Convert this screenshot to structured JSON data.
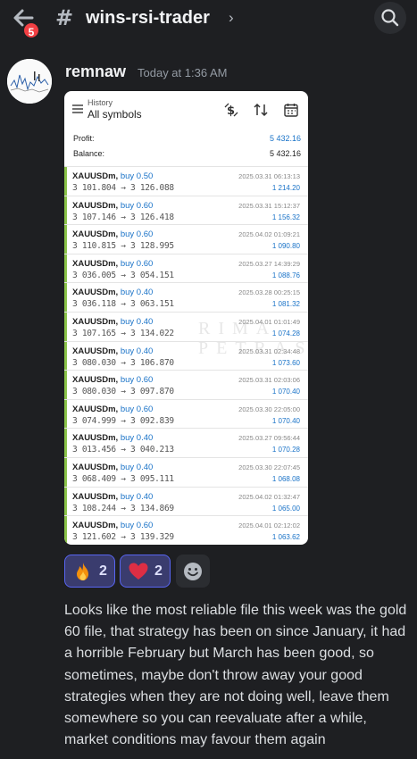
{
  "header": {
    "channel_name": "wins-rsi-trader",
    "unread_count": "5",
    "channel_prefix": "#",
    "chevron": "›"
  },
  "message": {
    "author": "remnaw",
    "timestamp": "Today at 1:36 AM",
    "text": "Looks like the most reliable file this week was the gold 60 file, that strategy has been on since January,  it had a horrible February but March has been good, so sometimes, maybe don't throw away your good strategies when they are not doing well, leave them somewhere so you can reevaluate after a while, market conditions may favour them again"
  },
  "attachment": {
    "history_label": "History",
    "filter_label": "All symbols",
    "profit_label": "Profit:",
    "profit_value": "5 432.16",
    "balance_label": "Balance:",
    "balance_value": "5 432.16",
    "watermark_line1": "RIMA",
    "watermark_line2": "PETRAS",
    "trades": [
      {
        "symbol": "XAUUSDm,",
        "side": "buy 0.50",
        "prices": "3 101.804 → 3 126.088",
        "datetime": "2025.03.31 06:13:13",
        "pl": "1 214.20"
      },
      {
        "symbol": "XAUUSDm,",
        "side": "buy 0.60",
        "prices": "3 107.146 → 3 126.418",
        "datetime": "2025.03.31 15:12:37",
        "pl": "1 156.32"
      },
      {
        "symbol": "XAUUSDm,",
        "side": "buy 0.60",
        "prices": "3 110.815 → 3 128.995",
        "datetime": "2025.04.02 01:09:21",
        "pl": "1 090.80"
      },
      {
        "symbol": "XAUUSDm,",
        "side": "buy 0.60",
        "prices": "3 036.005 → 3 054.151",
        "datetime": "2025.03.27 14:39:29",
        "pl": "1 088.76"
      },
      {
        "symbol": "XAUUSDm,",
        "side": "buy 0.40",
        "prices": "3 036.118 → 3 063.151",
        "datetime": "2025.03.28 00:25:15",
        "pl": "1 081.32"
      },
      {
        "symbol": "XAUUSDm,",
        "side": "buy 0.40",
        "prices": "3 107.165 → 3 134.022",
        "datetime": "2025.04.01 01:01:49",
        "pl": "1 074.28"
      },
      {
        "symbol": "XAUUSDm,",
        "side": "buy 0.40",
        "prices": "3 080.030 → 3 106.870",
        "datetime": "2025.03.31 02:34:48",
        "pl": "1 073.60"
      },
      {
        "symbol": "XAUUSDm,",
        "side": "buy 0.60",
        "prices": "3 080.030 → 3 097.870",
        "datetime": "2025.03.31 02:03:06",
        "pl": "1 070.40"
      },
      {
        "symbol": "XAUUSDm,",
        "side": "buy 0.60",
        "prices": "3 074.999 → 3 092.839",
        "datetime": "2025.03.30 22:05:00",
        "pl": "1 070.40"
      },
      {
        "symbol": "XAUUSDm,",
        "side": "buy 0.40",
        "prices": "3 013.456 → 3 040.213",
        "datetime": "2025.03.27 09:56:44",
        "pl": "1 070.28"
      },
      {
        "symbol": "XAUUSDm,",
        "side": "buy 0.40",
        "prices": "3 068.409 → 3 095.111",
        "datetime": "2025.03.30 22:07:45",
        "pl": "1 068.08"
      },
      {
        "symbol": "XAUUSDm,",
        "side": "buy 0.40",
        "prices": "3 108.244 → 3 134.869",
        "datetime": "2025.04.02 01:32:47",
        "pl": "1 065.00"
      },
      {
        "symbol": "XAUUSDm,",
        "side": "buy 0.60",
        "prices": "3 121.602 → 3 139.329",
        "datetime": "2025.04.01 02:12:02",
        "pl": "1 063.62"
      }
    ]
  },
  "reactions": [
    {
      "emoji": "fire",
      "count": "2"
    },
    {
      "emoji": "red-heart",
      "count": "2"
    }
  ],
  "colors": {
    "background": "#1e1f22",
    "reaction_bg": "#3a3c6e",
    "reaction_border": "#5865f2",
    "badge": "#f23f43",
    "buy_blue": "#1a73c8",
    "trade_bar": "#8bc34a"
  }
}
